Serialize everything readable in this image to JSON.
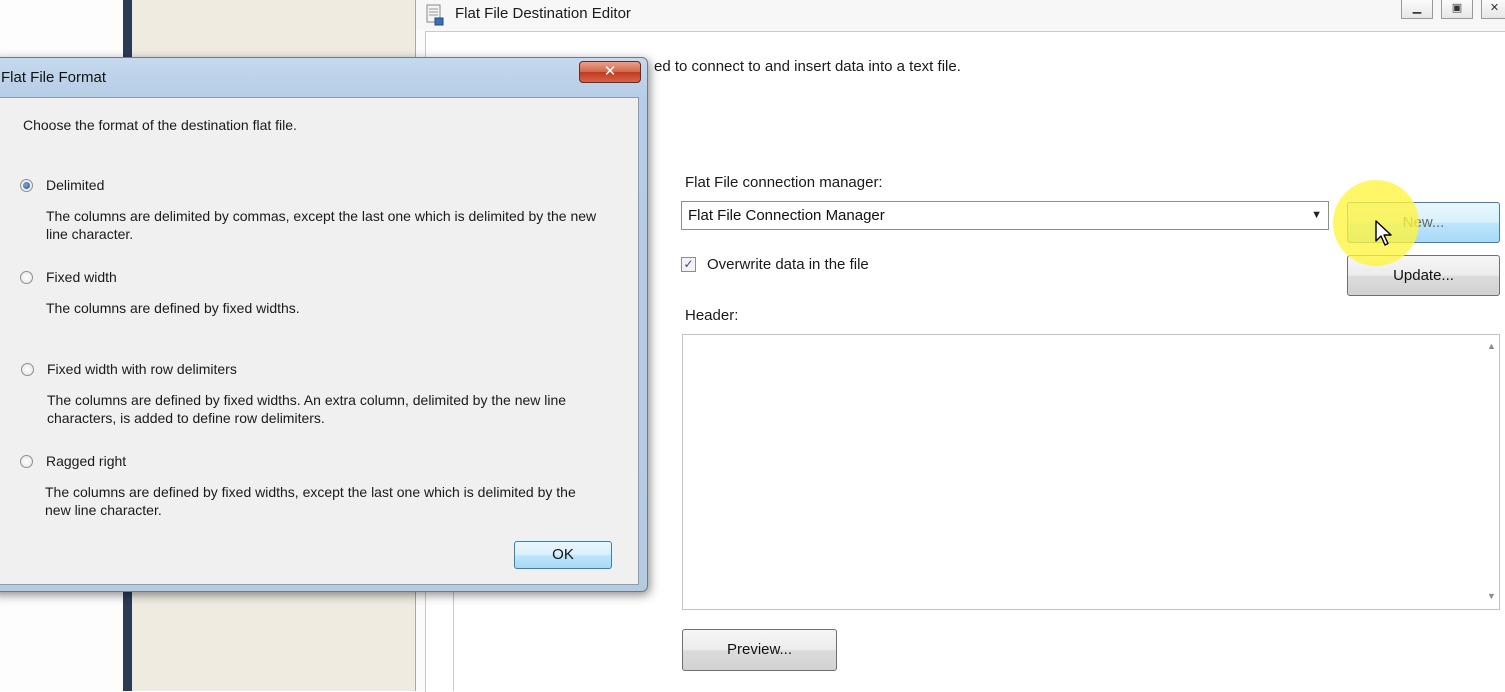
{
  "editor": {
    "title": "Flat File Destination Editor",
    "description": "ed to connect to and insert data into a text file.",
    "connection_label": "Flat File connection manager:",
    "connection_value": "Flat File Connection Manager",
    "new_label": "New...",
    "update_label": "Update...",
    "overwrite_label": "Overwrite data in the file",
    "overwrite_checked": true,
    "header_label": "Header:",
    "header_value": "",
    "preview_label": "Preview..."
  },
  "dialog": {
    "title": "Flat File Format",
    "instruction": "Choose the format of the destination flat file.",
    "options": [
      {
        "label": "Delimited",
        "selected": true,
        "description_line1": "The columns are delimited by commas, except the last one which is delimited by the new",
        "description_line2": "line character."
      },
      {
        "label": "Fixed width",
        "selected": false,
        "description_line1": "The columns are defined by fixed widths.",
        "description_line2": ""
      },
      {
        "label": "Fixed width with row delimiters",
        "selected": false,
        "description_line1": "The columns are defined by fixed widths. An extra column, delimited by the new line",
        "description_line2": "characters, is added to define row delimiters."
      },
      {
        "label": "Ragged right",
        "selected": false,
        "description_line1": "The columns are defined by fixed widths, except the last one which is delimited by the",
        "description_line2": "new line character."
      }
    ],
    "ok_label": "OK",
    "close_symbol": "✕"
  },
  "colors": {
    "accent_highlight": "#ffff3c",
    "dialog_frame": "#b5cde6",
    "close_button": "#c23a1e"
  }
}
